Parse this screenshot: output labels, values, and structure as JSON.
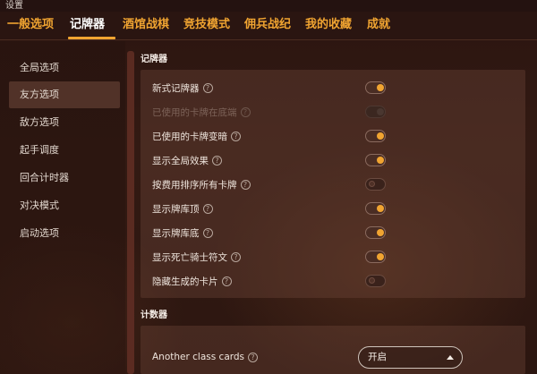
{
  "window": {
    "title": "设置"
  },
  "tabs": [
    {
      "label": "一般选项",
      "active": false
    },
    {
      "label": "记牌器",
      "active": true
    },
    {
      "label": "酒馆战棋",
      "active": false
    },
    {
      "label": "竞技模式",
      "active": false
    },
    {
      "label": "佣兵战纪",
      "active": false
    },
    {
      "label": "我的收藏",
      "active": false
    },
    {
      "label": "成就",
      "active": false
    }
  ],
  "sidebar": {
    "items": [
      {
        "label": "全局选项",
        "active": false
      },
      {
        "label": "友方选项",
        "active": true
      },
      {
        "label": "敌方选项",
        "active": false
      },
      {
        "label": "起手调度",
        "active": false
      },
      {
        "label": "回合计时器",
        "active": false
      },
      {
        "label": "对决模式",
        "active": false
      },
      {
        "label": "启动选项",
        "active": false
      }
    ]
  },
  "sections": {
    "tracker": {
      "title": "记牌器",
      "options": [
        {
          "label": "新式记牌器",
          "help": "?",
          "state": "on",
          "enabled": true
        },
        {
          "label": "已使用的卡牌在底端",
          "help": "?",
          "state": "on",
          "enabled": false
        },
        {
          "label": "已使用的卡牌变暗",
          "help": "?",
          "state": "on",
          "enabled": true
        },
        {
          "label": "显示全局效果",
          "help": "?",
          "state": "on",
          "enabled": true
        },
        {
          "label": "按费用排序所有卡牌",
          "help": "?",
          "state": "off",
          "enabled": true
        },
        {
          "label": "显示牌库顶",
          "help": "?",
          "state": "on",
          "enabled": true
        },
        {
          "label": "显示牌库底",
          "help": "?",
          "state": "on",
          "enabled": true
        },
        {
          "label": "显示死亡骑士符文",
          "help": "?",
          "state": "on",
          "enabled": true
        },
        {
          "label": "隐藏生成的卡片",
          "help": "?",
          "state": "off",
          "enabled": true
        }
      ]
    },
    "counters": {
      "title": "计数器",
      "option": {
        "label": "Another class cards",
        "help": "?",
        "selected": "开启"
      }
    }
  },
  "colors": {
    "accent": "#f0a431",
    "background": "#2b1510",
    "panel": "#5a3a30"
  },
  "icons": {
    "help": "help-circle-icon",
    "dropdown": "chevron-up-icon"
  }
}
